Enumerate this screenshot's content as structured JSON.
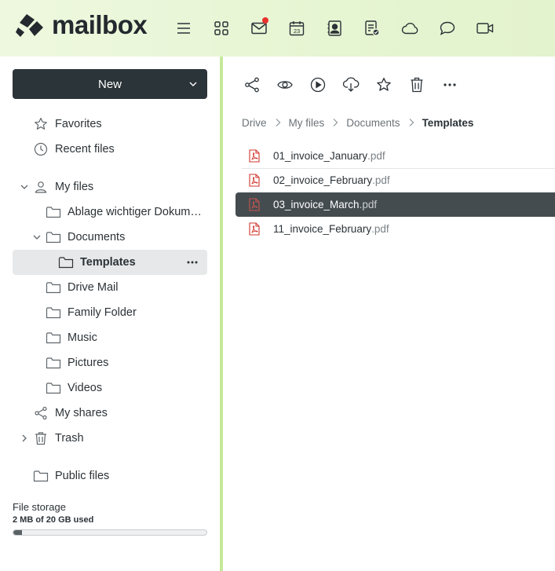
{
  "app": {
    "logo_text": "mailbox"
  },
  "header": {
    "icons": [
      "menu-icon",
      "apps-grid-icon",
      "mail-icon",
      "calendar-icon",
      "contacts-icon",
      "tasks-icon",
      "cloud-icon",
      "chat-icon",
      "video-icon"
    ],
    "calendar_day": "23",
    "mail_badge_color": "#e8322c",
    "accent_color": "#c6e89a"
  },
  "sidebar": {
    "new_label": "New",
    "favorites": "Favorites",
    "recent": "Recent files",
    "my_files": "My files",
    "ablage": "Ablage wichtiger Dokumente",
    "documents": "Documents",
    "templates": "Templates",
    "drive_mail": "Drive Mail",
    "family": "Family Folder",
    "music": "Music",
    "pictures": "Pictures",
    "videos": "Videos",
    "my_shares": "My shares",
    "trash": "Trash",
    "public_files": "Public files"
  },
  "storage": {
    "title": "File storage",
    "used_text": "2 MB of 20 GB used",
    "used_fraction": 0.0001
  },
  "toolbar": {
    "icons": [
      "share-icon",
      "preview-eye-icon",
      "play-icon",
      "download-cloud-icon",
      "favorite-star-icon",
      "delete-trash-icon",
      "more-icon"
    ]
  },
  "breadcrumb": {
    "items": [
      "Drive",
      "My files",
      "Documents"
    ],
    "current": "Templates"
  },
  "files": [
    {
      "name": "01_invoice_January",
      "ext": ".pdf"
    },
    {
      "name": "02_invoice_February",
      "ext": ".pdf"
    },
    {
      "name": "03_invoice_March",
      "ext": ".pdf"
    },
    {
      "name": "11_invoice_February",
      "ext": ".pdf"
    }
  ],
  "selected_file_index": 2
}
